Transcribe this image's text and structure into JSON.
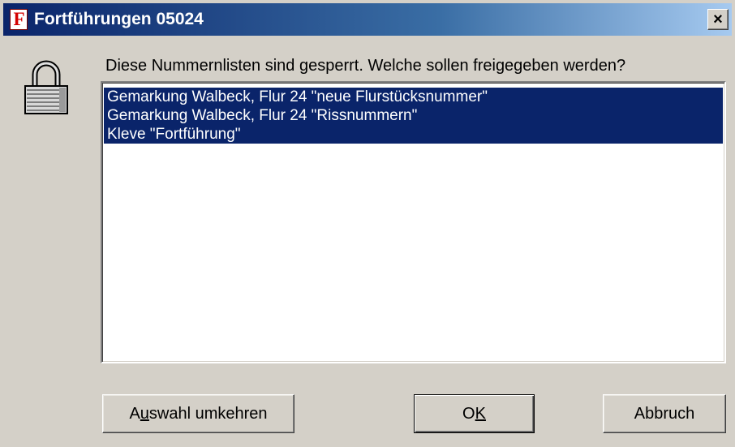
{
  "window": {
    "title": "Fortführungen 05024",
    "app_icon_letter": "F",
    "close_symbol": "×"
  },
  "dialog": {
    "prompt": "Diese Nummernlisten sind gesperrt. Welche sollen freigegeben werden?",
    "icon": "lock-icon",
    "items": [
      {
        "label": "Gemarkung Walbeck, Flur 24  \"neue Flurstücksnummer\"",
        "selected": true
      },
      {
        "label": "Gemarkung Walbeck, Flur 24  \"Rissnummern\"",
        "selected": true
      },
      {
        "label": "Kleve  \"Fortführung\"",
        "selected": true
      }
    ]
  },
  "buttons": {
    "invert": {
      "pre": "A",
      "mnemonic": "u",
      "post": "swahl umkehren"
    },
    "ok": {
      "pre": "O",
      "mnemonic": "K",
      "post": ""
    },
    "cancel": "Abbruch"
  },
  "colors": {
    "title_gradient_start": "#0a246a",
    "title_gradient_end": "#a6caf0",
    "selection": "#0a246a",
    "dialog_face": "#d4d0c8"
  }
}
